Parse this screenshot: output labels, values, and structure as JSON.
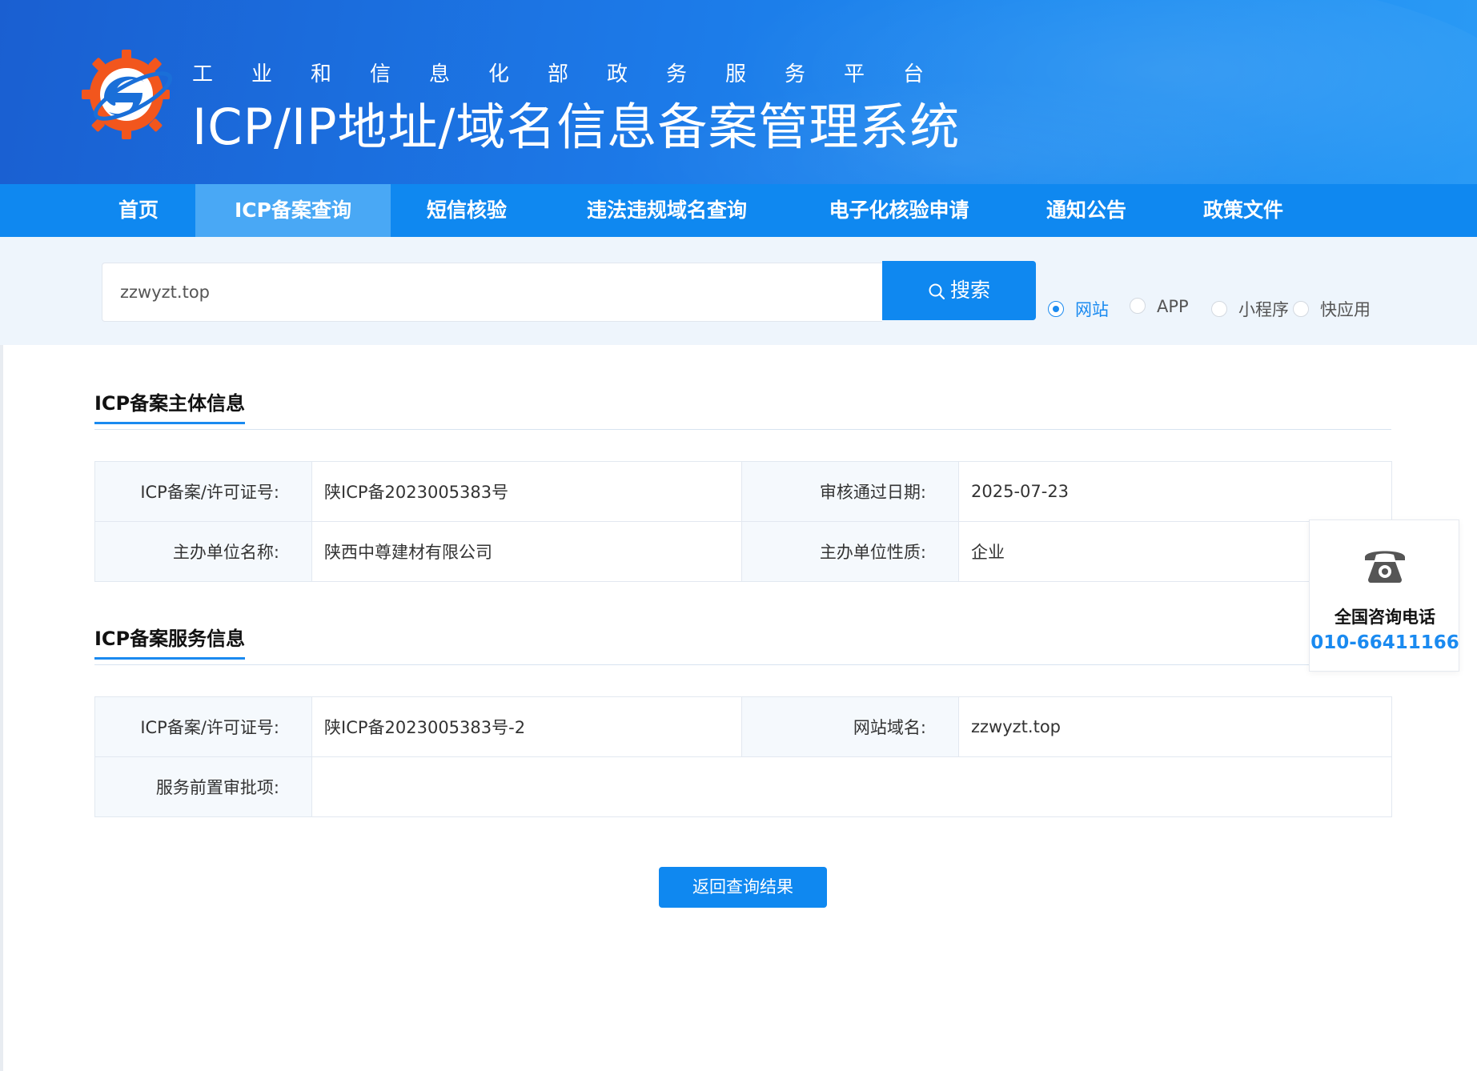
{
  "header": {
    "subtitle": "工业和信息化部政务服务平台",
    "title": "ICP/IP地址/域名信息备案管理系统"
  },
  "nav": {
    "items": [
      {
        "label": "首页",
        "active": false
      },
      {
        "label": "ICP备案查询",
        "active": true
      },
      {
        "label": "短信核验",
        "active": false
      },
      {
        "label": "违法违规域名查询",
        "active": false
      },
      {
        "label": "电子化核验申请",
        "active": false
      },
      {
        "label": "通知公告",
        "active": false
      },
      {
        "label": "政策文件",
        "active": false
      }
    ]
  },
  "search": {
    "value": "zzwyzt.top",
    "button_label": "搜索",
    "options": [
      {
        "label": "网站",
        "checked": true
      },
      {
        "label": "APP",
        "checked": false
      },
      {
        "label": "小程序",
        "checked": false
      },
      {
        "label": "快应用",
        "checked": false
      }
    ]
  },
  "subject": {
    "title": "ICP备案主体信息",
    "license_label": "ICP备案/许可证号:",
    "license_value": "陕ICP备2023005383号",
    "approval_date_label": "审核通过日期:",
    "approval_date_value": "2025-07-23",
    "org_name_label": "主办单位名称:",
    "org_name_value": "陕西中尊建材有限公司",
    "org_type_label": "主办单位性质:",
    "org_type_value": "企业"
  },
  "service": {
    "title": "ICP备案服务信息",
    "license_label": "ICP备案/许可证号:",
    "license_value": "陕ICP备2023005383号-2",
    "domain_label": "网站域名:",
    "domain_value": "zzwyzt.top",
    "preapproval_label": "服务前置审批项:",
    "preapproval_value": ""
  },
  "return_button": "返回查询结果",
  "contact": {
    "icon": "telephone-icon",
    "label": "全国咨询电话",
    "number": "010-66411166"
  },
  "colors": {
    "primary": "#0f88f0",
    "nav_active": "#49a8f5",
    "logo_orange": "#f2561d"
  }
}
